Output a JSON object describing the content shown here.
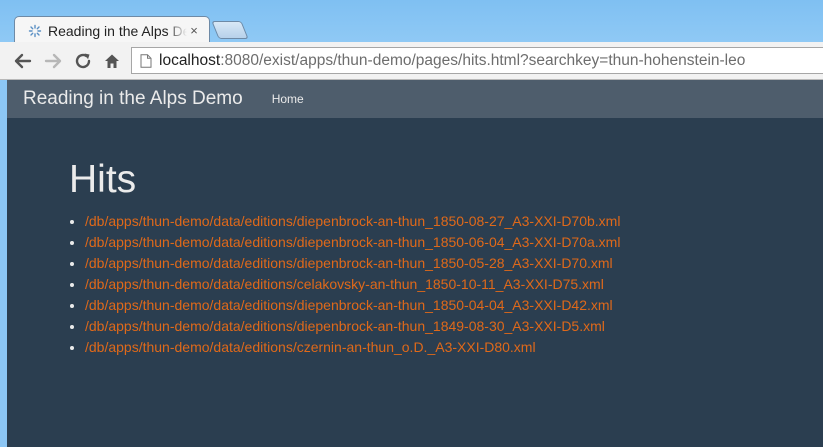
{
  "browser": {
    "tab": {
      "title": "Reading in the Alps Demo",
      "close": "×"
    },
    "url": {
      "host": "localhost",
      "rest": ":8080/exist/apps/thun-demo/pages/hits.html?searchkey=thun-hohenstein-leo"
    }
  },
  "colors": {
    "navbar": "#4e5d6c",
    "page_bg": "#2b3e50",
    "link": "#df691a",
    "text": "#ebebeb"
  },
  "navbar": {
    "brand": "Reading in the Alps Demo",
    "links": [
      "Home"
    ]
  },
  "main": {
    "heading": "Hits",
    "hits": [
      "/db/apps/thun-demo/data/editions/diepenbrock-an-thun_1850-08-27_A3-XXI-D70b.xml",
      "/db/apps/thun-demo/data/editions/diepenbrock-an-thun_1850-06-04_A3-XXI-D70a.xml",
      "/db/apps/thun-demo/data/editions/diepenbrock-an-thun_1850-05-28_A3-XXI-D70.xml",
      "/db/apps/thun-demo/data/editions/celakovsky-an-thun_1850-10-11_A3-XXI-D75.xml",
      "/db/apps/thun-demo/data/editions/diepenbrock-an-thun_1850-04-04_A3-XXI-D42.xml",
      "/db/apps/thun-demo/data/editions/diepenbrock-an-thun_1849-08-30_A3-XXI-D5.xml",
      "/db/apps/thun-demo/data/editions/czernin-an-thun_o.D._A3-XXI-D80.xml"
    ]
  }
}
